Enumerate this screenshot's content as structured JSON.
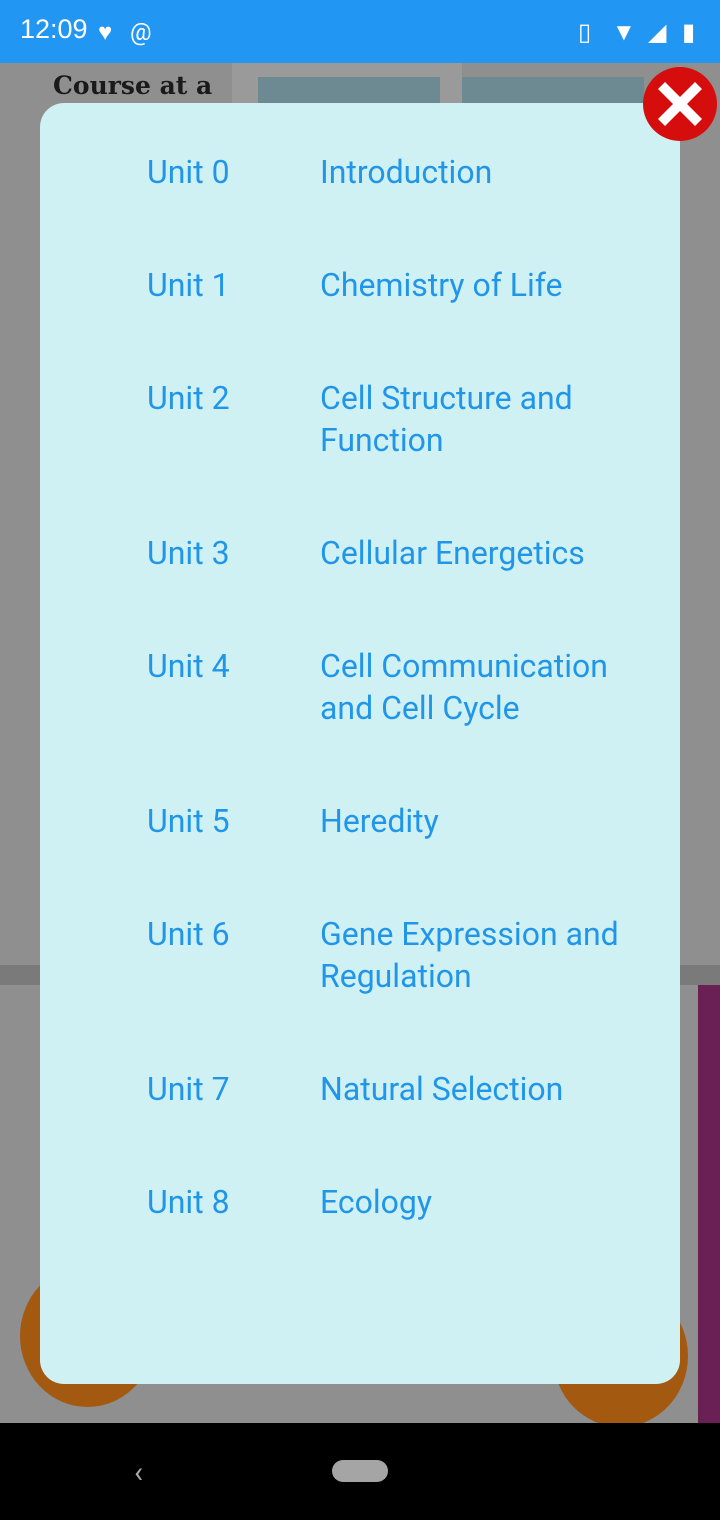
{
  "status_bar": {
    "time": "12:09",
    "icons": [
      "heart-check-icon",
      "at-sign-icon",
      "vibrate-icon",
      "wifi-icon",
      "signal-icon",
      "battery-charging-icon"
    ]
  },
  "background": {
    "title": "Course at a Glance"
  },
  "modal": {
    "close_icon": "close-icon",
    "accent_color": "#2196e8",
    "units": [
      {
        "unit": "Unit 0",
        "title": "Introduction"
      },
      {
        "unit": "Unit 1",
        "title": "Chemistry of Life"
      },
      {
        "unit": "Unit 2",
        "title": "Cell Structure and Function"
      },
      {
        "unit": "Unit 3",
        "title": "Cellular Energetics"
      },
      {
        "unit": "Unit 4",
        "title": "Cell Communication and Cell Cycle"
      },
      {
        "unit": "Unit 5",
        "title": "Heredity"
      },
      {
        "unit": "Unit 6",
        "title": "Gene Expression and Regulation"
      },
      {
        "unit": "Unit 7",
        "title": "Natural Selection"
      },
      {
        "unit": "Unit 8",
        "title": "Ecology"
      }
    ]
  }
}
